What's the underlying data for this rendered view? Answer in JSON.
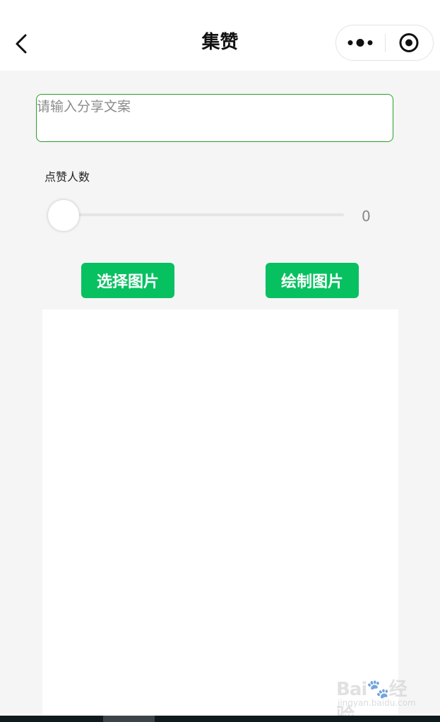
{
  "header": {
    "title": "集赞"
  },
  "form": {
    "share_placeholder": "请输入分享文案",
    "share_value": "",
    "likes_label": "点赞人数",
    "likes_value": "0",
    "slider_fraction": 0
  },
  "buttons": {
    "select_label": "选择图片",
    "draw_label": "绘制图片"
  },
  "watermark": {
    "brand": "Bai",
    "brand_cn": "经验",
    "url": "jingyan.baidu.com"
  },
  "colors": {
    "accent": "#07c160",
    "input_border": "#2a9d2a",
    "background": "#f5f5f5"
  },
  "icons": {
    "back": "chevron-left-icon",
    "more": "more-dots-icon",
    "target": "target-circle-icon"
  }
}
